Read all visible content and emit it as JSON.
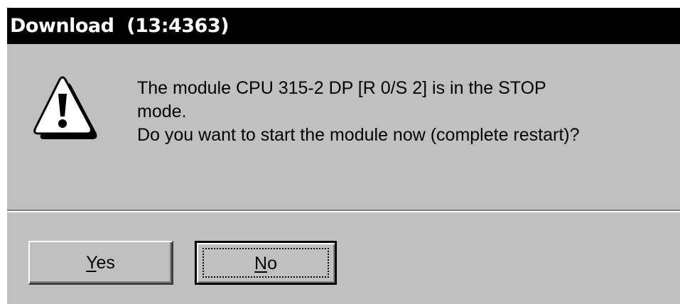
{
  "dialog": {
    "title": "Download  (13:4363)",
    "icon": "warning-icon",
    "message_lines": [
      "The module CPU 315-2 DP [R 0/S 2] is in the STOP",
      "mode.",
      "Do you want to start the module now (complete restart)?"
    ]
  },
  "buttons": {
    "yes": {
      "mnemonic": "Y",
      "rest": "es"
    },
    "no": {
      "mnemonic": "N",
      "rest": "o"
    }
  },
  "colors": {
    "window_bg": "#c0c0c0",
    "titlebar_bg": "#000000",
    "titlebar_text": "#ffffff"
  }
}
